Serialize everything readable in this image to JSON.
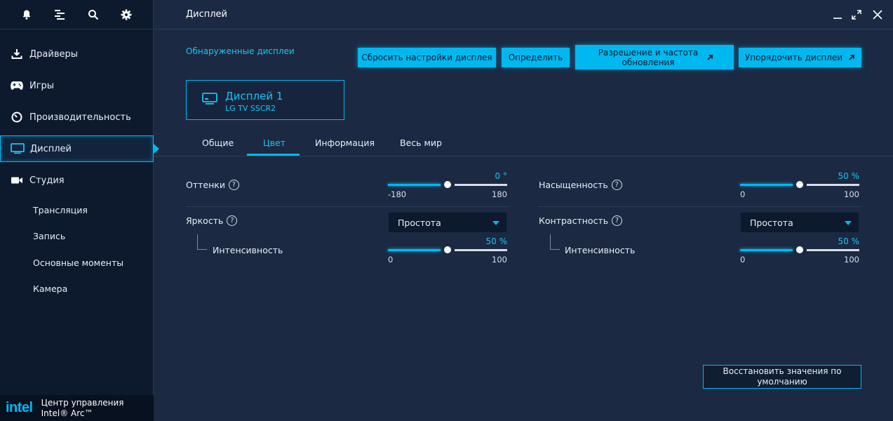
{
  "app": {
    "brand_logo": "intel",
    "brand_line1": "Центр управления",
    "brand_line2": "Intel® Arc™"
  },
  "topbar_icons": [
    "bell-icon",
    "list-icon",
    "search-icon",
    "gear-icon"
  ],
  "sidebar": {
    "items": [
      {
        "label": "Драйверы",
        "icon": "download-icon"
      },
      {
        "label": "Игры",
        "icon": "gamepad-icon"
      },
      {
        "label": "Производительность",
        "icon": "gauge-icon"
      },
      {
        "label": "Дисплей",
        "icon": "monitor-icon"
      },
      {
        "label": "Студия",
        "icon": "camera-icon"
      }
    ],
    "sub_items": [
      "Трансляция",
      "Запись",
      "Основные моменты",
      "Камера"
    ]
  },
  "header": {
    "title": "Дисплей"
  },
  "main": {
    "section_label": "Обнаруженные дисплеи",
    "buttons": {
      "reset": "Сбросить настройки дисплея",
      "identify": "Определить",
      "resolution": "Разрешение и частота обновления",
      "arrange": "Упорядочить дисплеи"
    },
    "display": {
      "name": "Дисплей 1",
      "model": "LG TV SSCR2"
    },
    "tabs": [
      "Общие",
      "Цвет",
      "Информация",
      "Весь мир"
    ],
    "active_tab": "Цвет",
    "hue": {
      "label": "Оттенки",
      "value_text": "0 °",
      "value": 0,
      "min": "-180",
      "max": "180"
    },
    "saturation": {
      "label": "Насыщенность",
      "value_text": "50 %",
      "value": 50,
      "min": "0",
      "max": "100"
    },
    "brightness": {
      "label": "Яркость",
      "select": "Простота",
      "intensity_label": "Интенсивность",
      "value_text": "50 %",
      "value": 50,
      "min": "0",
      "max": "100"
    },
    "contrast": {
      "label": "Контрастность",
      "select": "Простота",
      "intensity_label": "Интенсивность",
      "value_text": "50 %",
      "value": 50,
      "min": "0",
      "max": "100"
    },
    "restore_button": "Восстановить значения по умолчанию"
  },
  "colors": {
    "accent": "#00b8f0",
    "sidebar_bg": "#0d1a2e",
    "content_bg": "#1b2a42"
  }
}
